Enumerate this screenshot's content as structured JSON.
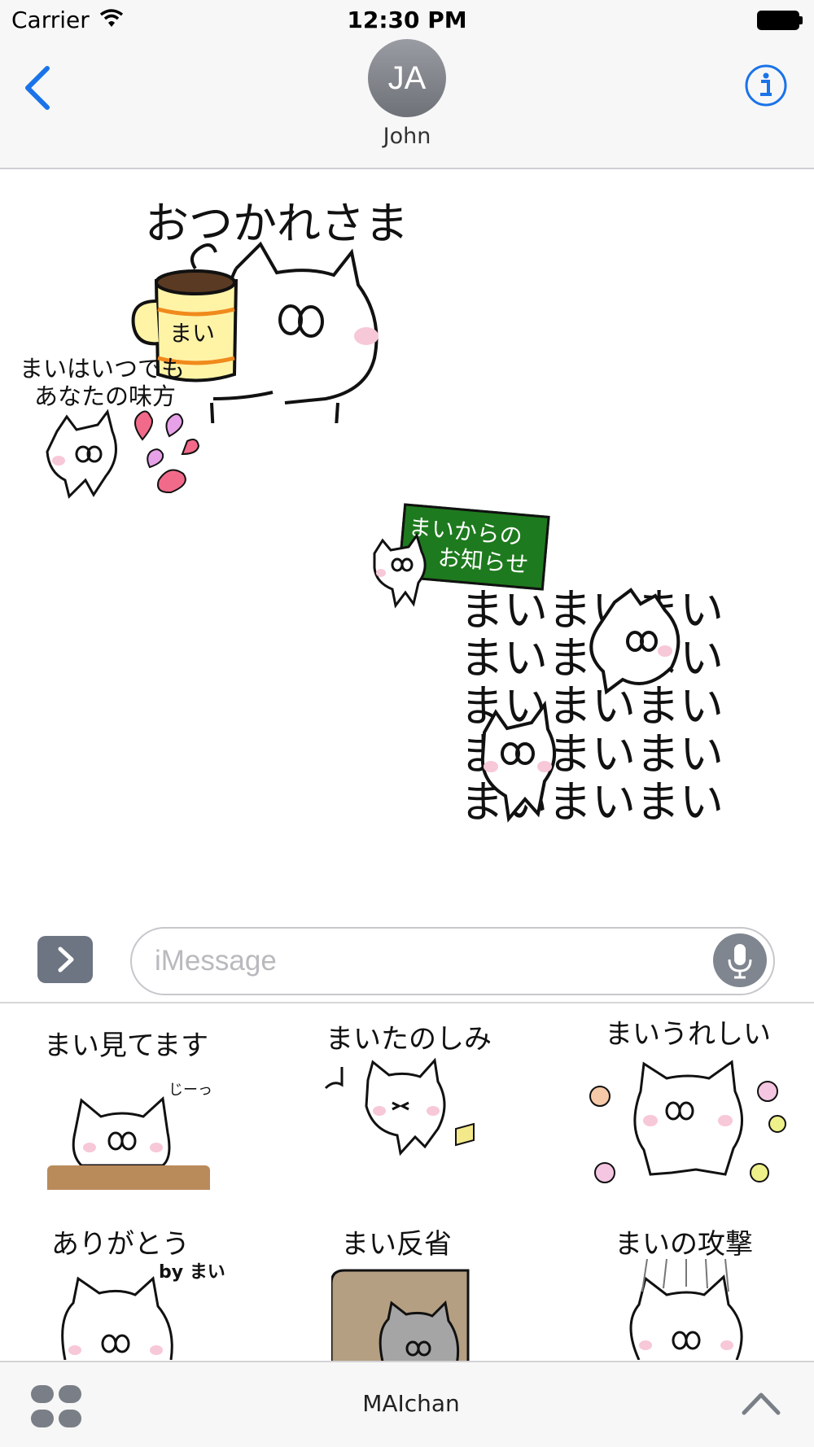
{
  "status_bar": {
    "carrier": "Carrier",
    "time": "12:30 PM"
  },
  "nav": {
    "avatar_initials": "JA",
    "contact_name": "John"
  },
  "messages": {
    "sticker1": {
      "caption": "おつかれさま",
      "mug_text": "まい"
    },
    "sticker2": {
      "line1": "まいはいつでも",
      "line2": "あなたの味方"
    },
    "sticker3": {
      "line1": "まいからの",
      "line2": "お知らせ"
    },
    "sticker4": {
      "lines": [
        "まいまいまい",
        "まいまいまい",
        "まいまいまい",
        "まいまいまい",
        "まいまいまい"
      ]
    }
  },
  "input": {
    "placeholder": "iMessage"
  },
  "drawer": {
    "stickers": [
      {
        "label": "まい見てます",
        "sub": "じーっ"
      },
      {
        "label": "まいたのしみ"
      },
      {
        "label": "まいうれしい"
      },
      {
        "label": "ありがとう",
        "sub": "by まい"
      },
      {
        "label": "まい反省"
      },
      {
        "label": "まいの攻撃"
      }
    ]
  },
  "bottom_bar": {
    "app_name": "MAIchan"
  },
  "colors": {
    "accent": "#1a73e8",
    "board_green": "#1e7a1e",
    "blush": "#f7c8d8"
  }
}
